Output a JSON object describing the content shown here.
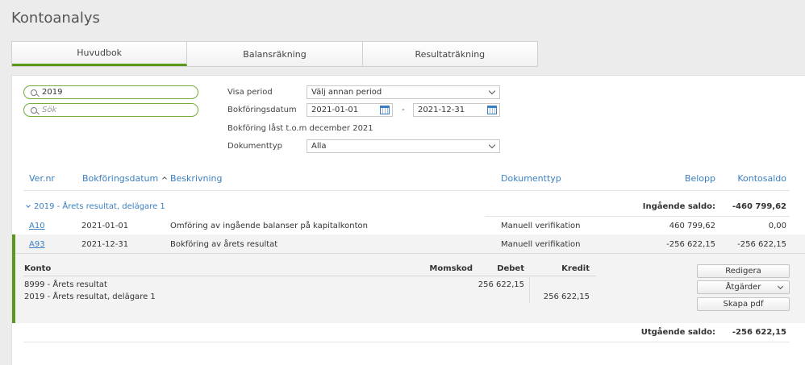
{
  "page": {
    "title": "Kontoanalys"
  },
  "tabs": [
    {
      "label": "Huvudbok",
      "active": true
    },
    {
      "label": "Balansräkning",
      "active": false
    },
    {
      "label": "Resultaträkning",
      "active": false
    }
  ],
  "filters": {
    "search1_value": "2019",
    "search2_placeholder": "Sök",
    "visa_period_label": "Visa period",
    "visa_period_value": "Välj annan period",
    "bokforingsdatum_label": "Bokföringsdatum",
    "date_from": "2021-01-01",
    "date_separator": "-",
    "date_to": "2021-12-31",
    "lock_note": "Bokföring låst t.o.m december 2021",
    "dokumenttyp_label": "Dokumenttyp",
    "dokumenttyp_value": "Alla"
  },
  "table": {
    "headers": {
      "vernr": "Ver.nr",
      "bokforingsdatum": "Bokföringsdatum",
      "beskrivning": "Beskrivning",
      "dokumenttyp": "Dokumenttyp",
      "belopp": "Belopp",
      "kontosaldo": "Kontosaldo"
    },
    "group_label": "2019 - Årets resultat, delägare 1",
    "ingaende_label": "Ingående saldo:",
    "ingaende_value": "-460 799,62",
    "rows": [
      {
        "vernr": "A10",
        "date": "2021-01-01",
        "desc": "Omföring av ingående balanser på kapitalkonton",
        "doctype": "Manuell verifikation",
        "belopp": "460 799,62",
        "saldo": "0,00"
      },
      {
        "vernr": "A93",
        "date": "2021-12-31",
        "desc": "Bokföring av årets resultat",
        "doctype": "Manuell verifikation",
        "belopp": "-256 622,15",
        "saldo": "-256 622,15"
      }
    ],
    "detail": {
      "headers": {
        "konto": "Konto",
        "momskod": "Momskod",
        "debet": "Debet",
        "kredit": "Kredit"
      },
      "lines": [
        {
          "konto": "8999 - Årets resultat",
          "debet": "256 622,15",
          "kredit": ""
        },
        {
          "konto": "2019 - Årets resultat, delägare 1",
          "debet": "",
          "kredit": "256 622,15"
        }
      ],
      "buttons": {
        "redigera": "Redigera",
        "atgarder": "Åtgärder",
        "skapa_pdf": "Skapa pdf"
      }
    },
    "utgaende_label": "Utgående saldo:",
    "utgaende_value": "-256 622,15"
  },
  "colors": {
    "accent_green": "#5a9a1b",
    "link_blue": "#3a7fc1"
  }
}
